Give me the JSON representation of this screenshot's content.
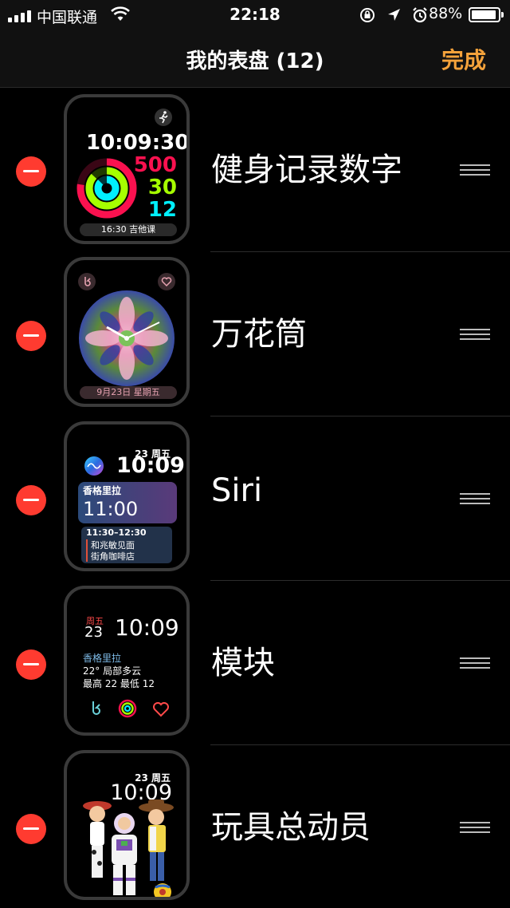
{
  "status_bar": {
    "carrier": "中国联通",
    "time": "22:18",
    "battery_percent": "88%",
    "battery_level": 0.88,
    "icons": [
      "signal-icon",
      "wifi-icon",
      "rotation-lock-icon",
      "location-icon",
      "alarm-icon",
      "battery-icon"
    ]
  },
  "nav": {
    "title": "我的表盘 (12)",
    "done_label": "完成",
    "done_color": "#f4a23b"
  },
  "faces": [
    {
      "name": "健身记录数字",
      "time": "10:09:30",
      "move": "500",
      "exercise": "30",
      "stand": "12",
      "event": "16:30 吉他课",
      "icon": "running-figure-icon"
    },
    {
      "name": "万花筒",
      "date": "9月23日 星期五",
      "icons": [
        "breathe-icon",
        "heart-icon"
      ]
    },
    {
      "name": "Siri",
      "date": "23 周五",
      "time": "10:09",
      "card1_title": "香格里拉",
      "card1_time": "11:00",
      "card2_time": "11:30–12:30",
      "card2_line1": "和兆敏见面",
      "card2_line2": "街角咖啡店",
      "icon": "siri-icon"
    },
    {
      "name": "模块",
      "weekday": "周五",
      "day": "23",
      "time": "10:09",
      "location": "香格里拉",
      "weather": "22° 局部多云",
      "range": "最高 22 最低 12",
      "icons": [
        "breathe-icon",
        "activity-rings-icon",
        "heart-icon"
      ]
    },
    {
      "name": "玩具总动员",
      "date": "23 周五",
      "time": "10:09"
    }
  ],
  "colors": {
    "delete": "#ff3b30",
    "move_red": "#fa114f",
    "exercise_green": "#a6ff00",
    "stand_cyan": "#00f0ff"
  }
}
